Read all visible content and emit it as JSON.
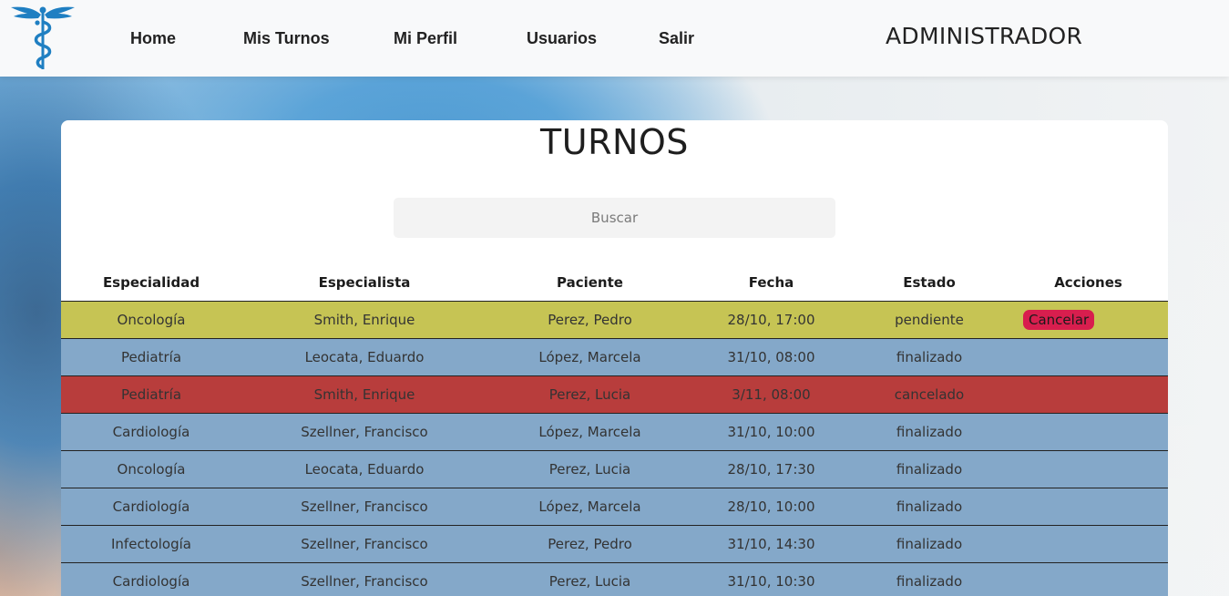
{
  "navbar": {
    "links": [
      {
        "label": "Home"
      },
      {
        "label": "Mis Turnos"
      },
      {
        "label": "Mi Perfil"
      },
      {
        "label": "Usuarios"
      },
      {
        "label": "Salir"
      }
    ],
    "role": "ADMINISTRADOR",
    "logo_icon": "caduceus-icon",
    "logo_color": "#1f7fc2"
  },
  "main": {
    "title": "TURNOS",
    "search": {
      "placeholder": "Buscar",
      "value": ""
    },
    "columns": [
      "Especialidad",
      "Especialista",
      "Paciente",
      "Fecha",
      "Estado",
      "Acciones"
    ],
    "cancel_label": "Cancelar",
    "rows": [
      {
        "especialidad": "Oncología",
        "especialista": "Smith, Enrique",
        "paciente": "Perez, Pedro",
        "fecha": "28/10, 17:00",
        "estado": "pendiente"
      },
      {
        "especialidad": "Pediatría",
        "especialista": "Leocata, Eduardo",
        "paciente": "López, Marcela",
        "fecha": "31/10, 08:00",
        "estado": "finalizado"
      },
      {
        "especialidad": "Pediatría",
        "especialista": "Smith, Enrique",
        "paciente": "Perez, Lucia",
        "fecha": "3/11, 08:00",
        "estado": "cancelado"
      },
      {
        "especialidad": "Cardiología",
        "especialista": "Szellner, Francisco",
        "paciente": "López, Marcela",
        "fecha": "31/10, 10:00",
        "estado": "finalizado"
      },
      {
        "especialidad": "Oncología",
        "especialista": "Leocata, Eduardo",
        "paciente": "Perez, Lucia",
        "fecha": "28/10, 17:30",
        "estado": "finalizado"
      },
      {
        "especialidad": "Cardiología",
        "especialista": "Szellner, Francisco",
        "paciente": "López, Marcela",
        "fecha": "28/10, 10:00",
        "estado": "finalizado"
      },
      {
        "especialidad": "Infectología",
        "especialista": "Szellner, Francisco",
        "paciente": "Perez, Pedro",
        "fecha": "31/10, 14:30",
        "estado": "finalizado"
      },
      {
        "especialidad": "Cardiología",
        "especialista": "Szellner, Francisco",
        "paciente": "Perez, Lucia",
        "fecha": "31/10, 10:30",
        "estado": "finalizado"
      }
    ]
  },
  "colors": {
    "pendiente": "#c6c454",
    "finalizado": "#84a8c9",
    "cancelado": "#b83d3c",
    "cancel_button": "#d81e4e"
  }
}
